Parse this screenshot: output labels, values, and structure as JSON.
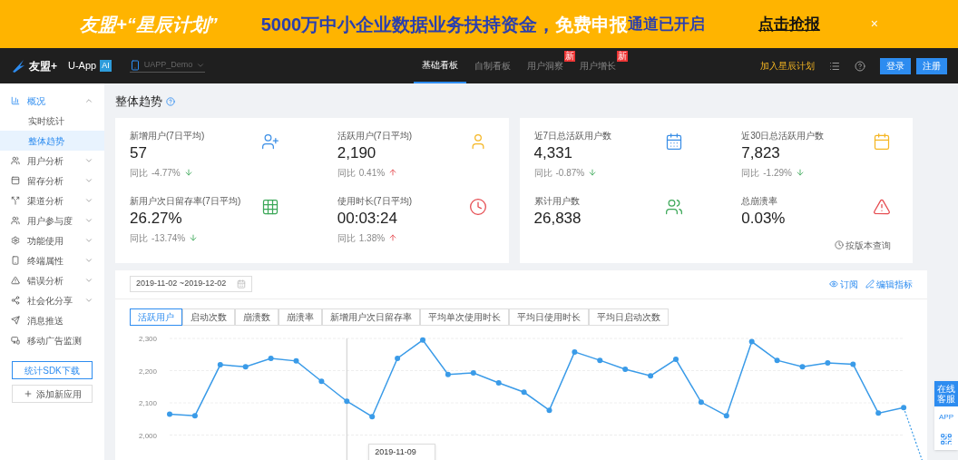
{
  "banner": {
    "brand": "友盟+“星辰计划”",
    "headline": "5000万中小企业数据业务扶持资金，",
    "highlight": "免费申报",
    "tail": "通道已开启",
    "cta": "点击抢报",
    "close": "×"
  },
  "header": {
    "logo": "友盟+",
    "product": "U-App",
    "badge": "AI",
    "app": "UAPP_Demo",
    "tabs": [
      {
        "label": "基础看板",
        "selected": true
      },
      {
        "label": "自制看板",
        "selected": false
      },
      {
        "label": "用户洞察",
        "selected": false,
        "badge": "新"
      },
      {
        "label": "用户增长",
        "selected": false,
        "badge": "新"
      }
    ],
    "join": "加入星辰计划",
    "login": "登录",
    "register": "注册"
  },
  "sidebar": {
    "items": [
      {
        "label": "概况",
        "expanded": true,
        "children": [
          {
            "label": "实时统计",
            "selected": false
          },
          {
            "label": "整体趋势",
            "selected": true
          }
        ]
      },
      {
        "label": "用户分析",
        "expanded": false
      },
      {
        "label": "留存分析",
        "expanded": false
      },
      {
        "label": "渠道分析",
        "expanded": false
      },
      {
        "label": "用户参与度",
        "expanded": false
      },
      {
        "label": "功能使用",
        "expanded": false
      },
      {
        "label": "终端属性",
        "expanded": false
      },
      {
        "label": "错误分析",
        "expanded": false
      },
      {
        "label": "社会化分享",
        "expanded": false
      },
      {
        "label": "消息推送"
      },
      {
        "label": "移动广告监测"
      }
    ],
    "sdk_button": "统计SDK下载",
    "add_button": "添加新应用"
  },
  "page_title": "整体趋势",
  "stat_panels": [
    [
      {
        "label": "新增用户(7日平均)",
        "value": "57",
        "compare": "同比",
        "change": "-4.77%",
        "increase": false
      },
      {
        "label": "活跃用户(7日平均)",
        "value": "2,190",
        "compare": "同比",
        "change": "0.41%",
        "increase": true
      },
      {
        "label": "新用户次日留存率(7日平均)",
        "value": "26.27%",
        "compare": "同比",
        "change": "-13.74%",
        "increase": false
      },
      {
        "label": "使用时长(7日平均)",
        "value": "00:03:24",
        "compare": "同比",
        "change": "1.38%",
        "increase": true
      }
    ],
    [
      {
        "label": "近7日总活跃用户数",
        "value": "4,331",
        "compare": "同比",
        "change": "-0.87%",
        "increase": false
      },
      {
        "label": "近30日总活跃用户数",
        "value": "7,823",
        "compare": "同比",
        "change": "-1.29%",
        "increase": false
      },
      {
        "label": "累计用户数",
        "value": "26,838"
      },
      {
        "label": "总崩溃率",
        "value": "0.03%",
        "link": "按版本查询"
      }
    ]
  ],
  "trend": {
    "date_range": "2019-11-02 ~2019-12-02",
    "subscribe": "订阅",
    "edit": "编辑指标",
    "tabs": [
      {
        "label": "活跃用户",
        "selected": true
      },
      {
        "label": "启动次数",
        "selected": false
      },
      {
        "label": "崩溃数",
        "selected": false
      },
      {
        "label": "崩溃率",
        "selected": false
      },
      {
        "label": "新增用户次日留存率",
        "selected": false
      },
      {
        "label": "平均单次使用时长",
        "selected": false
      },
      {
        "label": "平均日使用时长",
        "selected": false
      },
      {
        "label": "平均日启动次数",
        "selected": false
      }
    ],
    "tooltip": "2019-11-09",
    "chart_data": {
      "type": "line",
      "series": [
        {
          "color": "#3a9be8",
          "marker": "circle",
          "values": [
            2065,
            2060,
            2218,
            2212,
            2238,
            2230,
            2167,
            2105,
            2057,
            2238,
            2295,
            2188,
            2193,
            2162,
            2133,
            2077,
            2258,
            2232,
            2204,
            2184,
            2235,
            2102,
            2060,
            2290,
            2232,
            2212,
            2224,
            2220,
            2068,
            2085
          ]
        }
      ],
      "ylim": [
        2000,
        2300
      ],
      "yticks": [
        {
          "value": 2000,
          "label": "2,000"
        },
        {
          "value": 2100,
          "label": "2,100"
        },
        {
          "value": 2200,
          "label": "2,200"
        },
        {
          "value": 2300,
          "label": "2,300"
        }
      ]
    }
  },
  "side_float": {
    "service": "在线客服",
    "app": "APP"
  }
}
